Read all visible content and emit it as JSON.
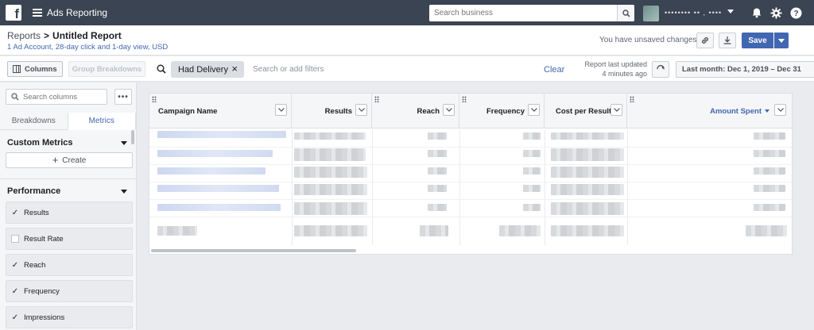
{
  "topbar": {
    "logo": "f",
    "app_title": "Ads Reporting",
    "search_placeholder": "Search business",
    "account_name": "•••••••• •• , ••••"
  },
  "header": {
    "breadcrumb_root": "Reports",
    "breadcrumb_sep": ">",
    "title": "Untitled Report",
    "subtitle": "1 Ad Account, 28-day click and 1-day view, USD",
    "unsaved": "You have unsaved changes",
    "save_label": "Save"
  },
  "toolbar": {
    "columns_label": "Columns",
    "group_breakdowns_label": "Group Breakdowns",
    "filter_chip": "Had Delivery",
    "filter_placeholder": "Search or add filters",
    "clear_label": "Clear",
    "last_updated_line1": "Report last updated",
    "last_updated_line2": "4 minutes ago",
    "date_range": "Last month: Dec 1, 2019 – Dec 31"
  },
  "sidebar": {
    "search_placeholder": "Search columns",
    "more_label": "•••",
    "tabs": [
      {
        "label": "Breakdowns",
        "active": false
      },
      {
        "label": "Metrics",
        "active": true
      }
    ],
    "custom_metrics_heading": "Custom Metrics",
    "create_label": "Create",
    "performance_heading": "Performance",
    "metrics": [
      {
        "label": "Results",
        "checked": true
      },
      {
        "label": "Result Rate",
        "checked": false
      },
      {
        "label": "Reach",
        "checked": true
      },
      {
        "label": "Frequency",
        "checked": true
      },
      {
        "label": "Impressions",
        "checked": true
      }
    ]
  },
  "table": {
    "columns": [
      {
        "label": "Campaign Name",
        "align": "left",
        "sorted": false
      },
      {
        "label": "Results",
        "align": "right",
        "sorted": false
      },
      {
        "label": "Reach",
        "align": "right",
        "sorted": false
      },
      {
        "label": "Frequency",
        "align": "right",
        "sorted": false
      },
      {
        "label": "Cost per Result",
        "align": "left",
        "sorted": false
      },
      {
        "label": "Amount Spent",
        "align": "right",
        "sorted": true
      }
    ]
  },
  "colors": {
    "topbar": "#3b4452",
    "accent": "#4267b2",
    "background": "#e9ebee"
  }
}
